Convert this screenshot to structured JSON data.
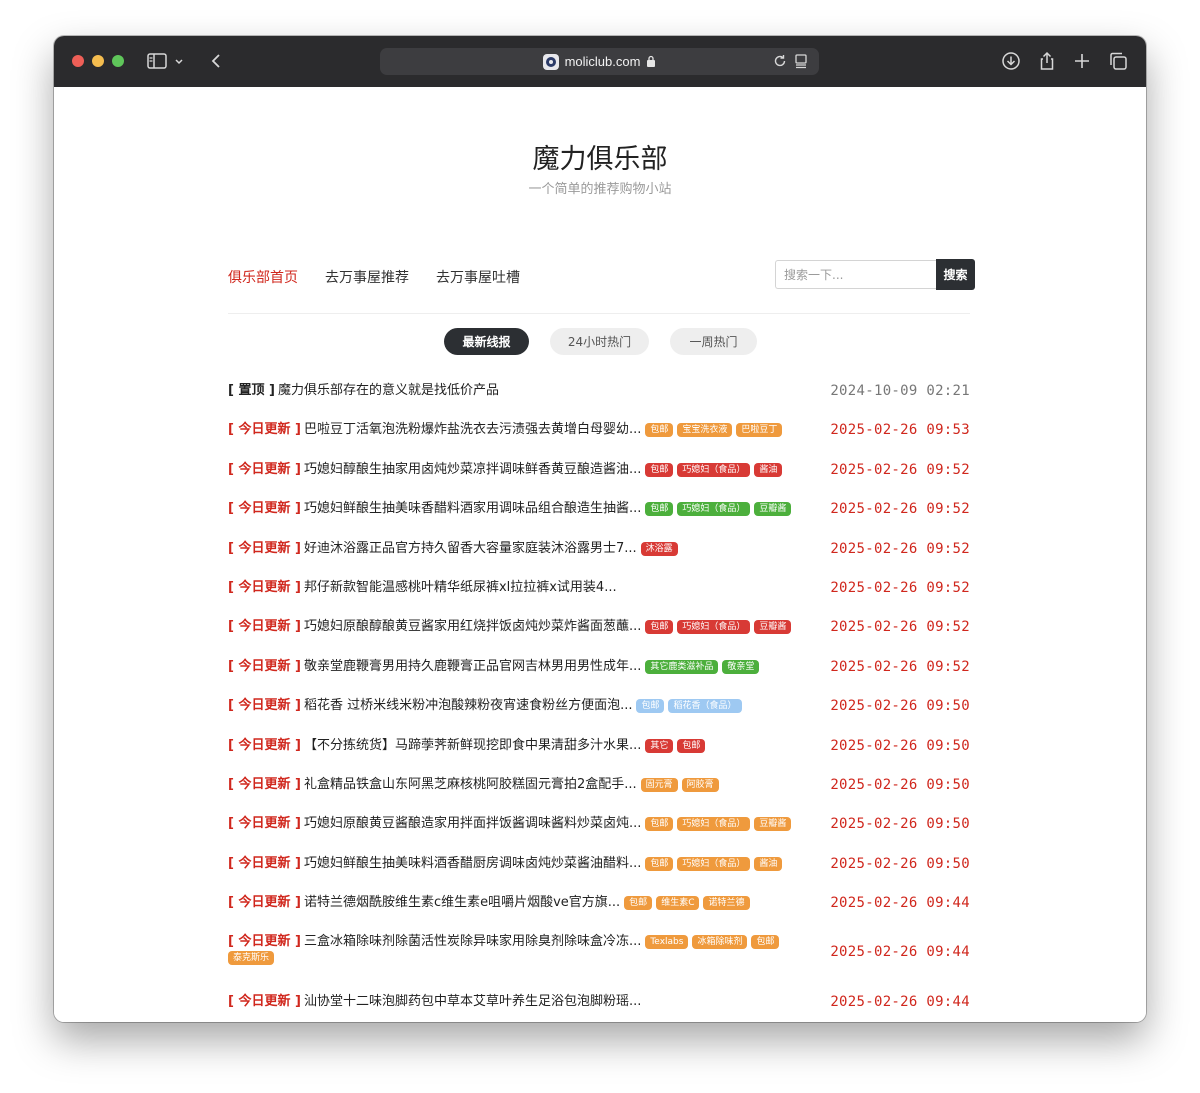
{
  "browser": {
    "url": "moliclub.com"
  },
  "site": {
    "title": "魔力俱乐部",
    "subtitle": "一个简单的推荐购物小站"
  },
  "nav": {
    "items": [
      {
        "label": "俱乐部首页",
        "active": true
      },
      {
        "label": "去万事屋推荐",
        "active": false
      },
      {
        "label": "去万事屋吐槽",
        "active": false
      }
    ]
  },
  "search": {
    "placeholder": "搜索一下...",
    "button": "搜索"
  },
  "tabs": [
    {
      "label": "最新线报",
      "active": true
    },
    {
      "label": "24小时热门",
      "active": false
    },
    {
      "label": "一周热门",
      "active": false
    }
  ],
  "colors": {
    "accent": "#d0271d",
    "orange": "#ef9a3d",
    "red": "#d83a35",
    "green": "#4caf3c",
    "light_blue": "#9ec9f2"
  },
  "posts": [
    {
      "prefix": "[ 置顶 ]",
      "pinned": true,
      "title": "魔力俱乐部存在的意义就是找低价产品",
      "tags": [],
      "time": "2024-10-09 02:21"
    },
    {
      "prefix": "[ 今日更新 ]",
      "title": "巴啦豆丁活氧泡洗粉爆炸盐洗衣去污渍强去黄增白母婴幼...",
      "tags": [
        {
          "label": "包邮",
          "color": "orange"
        },
        {
          "label": "宝宝洗衣液",
          "color": "orange"
        },
        {
          "label": "巴啦豆丁",
          "color": "orange"
        }
      ],
      "time": "2025-02-26 09:53"
    },
    {
      "prefix": "[ 今日更新 ]",
      "title": "巧媳妇醇酿生抽家用卤炖炒菜凉拌调味鲜香黄豆酿造酱油...",
      "tags": [
        {
          "label": "包邮",
          "color": "red"
        },
        {
          "label": "巧媳妇（食品）",
          "color": "red"
        },
        {
          "label": "酱油",
          "color": "red"
        }
      ],
      "time": "2025-02-26 09:52"
    },
    {
      "prefix": "[ 今日更新 ]",
      "title": "巧媳妇鲜酿生抽美味香醋料酒家用调味品组合酿造生抽酱...",
      "tags": [
        {
          "label": "包邮",
          "color": "green"
        },
        {
          "label": "巧媳妇（食品）",
          "color": "green"
        },
        {
          "label": "豆瓣酱",
          "color": "green"
        }
      ],
      "time": "2025-02-26 09:52"
    },
    {
      "prefix": "[ 今日更新 ]",
      "title": "好迪沐浴露正品官方持久留香大容量家庭装沐浴露男士7...",
      "tags": [
        {
          "label": "沐浴露",
          "color": "red"
        }
      ],
      "time": "2025-02-26 09:52"
    },
    {
      "prefix": "[ 今日更新 ]",
      "title": "邦仔新款智能温感桃叶精华纸尿裤xl拉拉裤x试用装4...",
      "tags": [],
      "time": "2025-02-26 09:52"
    },
    {
      "prefix": "[ 今日更新 ]",
      "title": "巧媳妇原酿醇酿黄豆酱家用红烧拌饭卤炖炒菜炸酱面葱蘸...",
      "tags": [
        {
          "label": "包邮",
          "color": "red"
        },
        {
          "label": "巧媳妇（食品）",
          "color": "red"
        },
        {
          "label": "豆瓣酱",
          "color": "red"
        }
      ],
      "time": "2025-02-26 09:52"
    },
    {
      "prefix": "[ 今日更新 ]",
      "title": "敬亲堂鹿鞭膏男用持久鹿鞭膏正品官网吉林男用男性成年...",
      "tags": [
        {
          "label": "其它鹿类滋补品",
          "color": "green"
        },
        {
          "label": "敬亲堂",
          "color": "green"
        }
      ],
      "time": "2025-02-26 09:52"
    },
    {
      "prefix": "[ 今日更新 ]",
      "title": "稻花香 过桥米线米粉冲泡酸辣粉夜宵速食粉丝方便面泡...",
      "tags": [
        {
          "label": "包邮",
          "color": "light_blue"
        },
        {
          "label": "稻花香（食品）",
          "color": "light_blue"
        }
      ],
      "time": "2025-02-26 09:50"
    },
    {
      "prefix": "[ 今日更新 ]",
      "title": "【不分拣统货】马蹄荸荠新鲜现挖即食中果清甜多汁水果...",
      "tags": [
        {
          "label": "其它",
          "color": "red"
        },
        {
          "label": "包邮",
          "color": "red"
        }
      ],
      "time": "2025-02-26 09:50"
    },
    {
      "prefix": "[ 今日更新 ]",
      "title": "礼盒精品铁盒山东阿黑芝麻核桃阿胶糕固元膏拍2盒配手...",
      "tags": [
        {
          "label": "固元膏",
          "color": "orange"
        },
        {
          "label": "阿胶膏",
          "color": "orange"
        }
      ],
      "time": "2025-02-26 09:50"
    },
    {
      "prefix": "[ 今日更新 ]",
      "title": "巧媳妇原酿黄豆酱酿造家用拌面拌饭酱调味酱料炒菜卤炖...",
      "tags": [
        {
          "label": "包邮",
          "color": "orange"
        },
        {
          "label": "巧媳妇（食品）",
          "color": "orange"
        },
        {
          "label": "豆瓣酱",
          "color": "orange"
        }
      ],
      "time": "2025-02-26 09:50"
    },
    {
      "prefix": "[ 今日更新 ]",
      "title": "巧媳妇鲜酿生抽美味料酒香醋厨房调味卤炖炒菜酱油醋料...",
      "tags": [
        {
          "label": "包邮",
          "color": "orange"
        },
        {
          "label": "巧媳妇（食品）",
          "color": "orange"
        },
        {
          "label": "酱油",
          "color": "orange"
        }
      ],
      "time": "2025-02-26 09:50"
    },
    {
      "prefix": "[ 今日更新 ]",
      "title": "诺特兰德烟酰胺维生素c维生素e咀嚼片烟酸ve官方旗...",
      "tags": [
        {
          "label": "包邮",
          "color": "orange"
        },
        {
          "label": "维生素C",
          "color": "orange"
        },
        {
          "label": "诺特兰德",
          "color": "orange"
        }
      ],
      "time": "2025-02-26 09:44"
    },
    {
      "prefix": "[ 今日更新 ]",
      "title": "三盒冰箱除味剂除菌活性炭除异味家用除臭剂除味盒冷冻...",
      "tags": [
        {
          "label": "Texlabs",
          "color": "orange"
        },
        {
          "label": "冰箱除味剂",
          "color": "orange"
        },
        {
          "label": "包邮",
          "color": "orange"
        },
        {
          "label": "泰克斯乐",
          "color": "orange"
        }
      ],
      "time": "2025-02-26 09:44"
    },
    {
      "prefix": "[ 今日更新 ]",
      "title": "汕协堂十二味泡脚药包中草本艾草叶养生足浴包泡脚粉瑶...",
      "tags": [],
      "time": "2025-02-26 09:44"
    }
  ]
}
